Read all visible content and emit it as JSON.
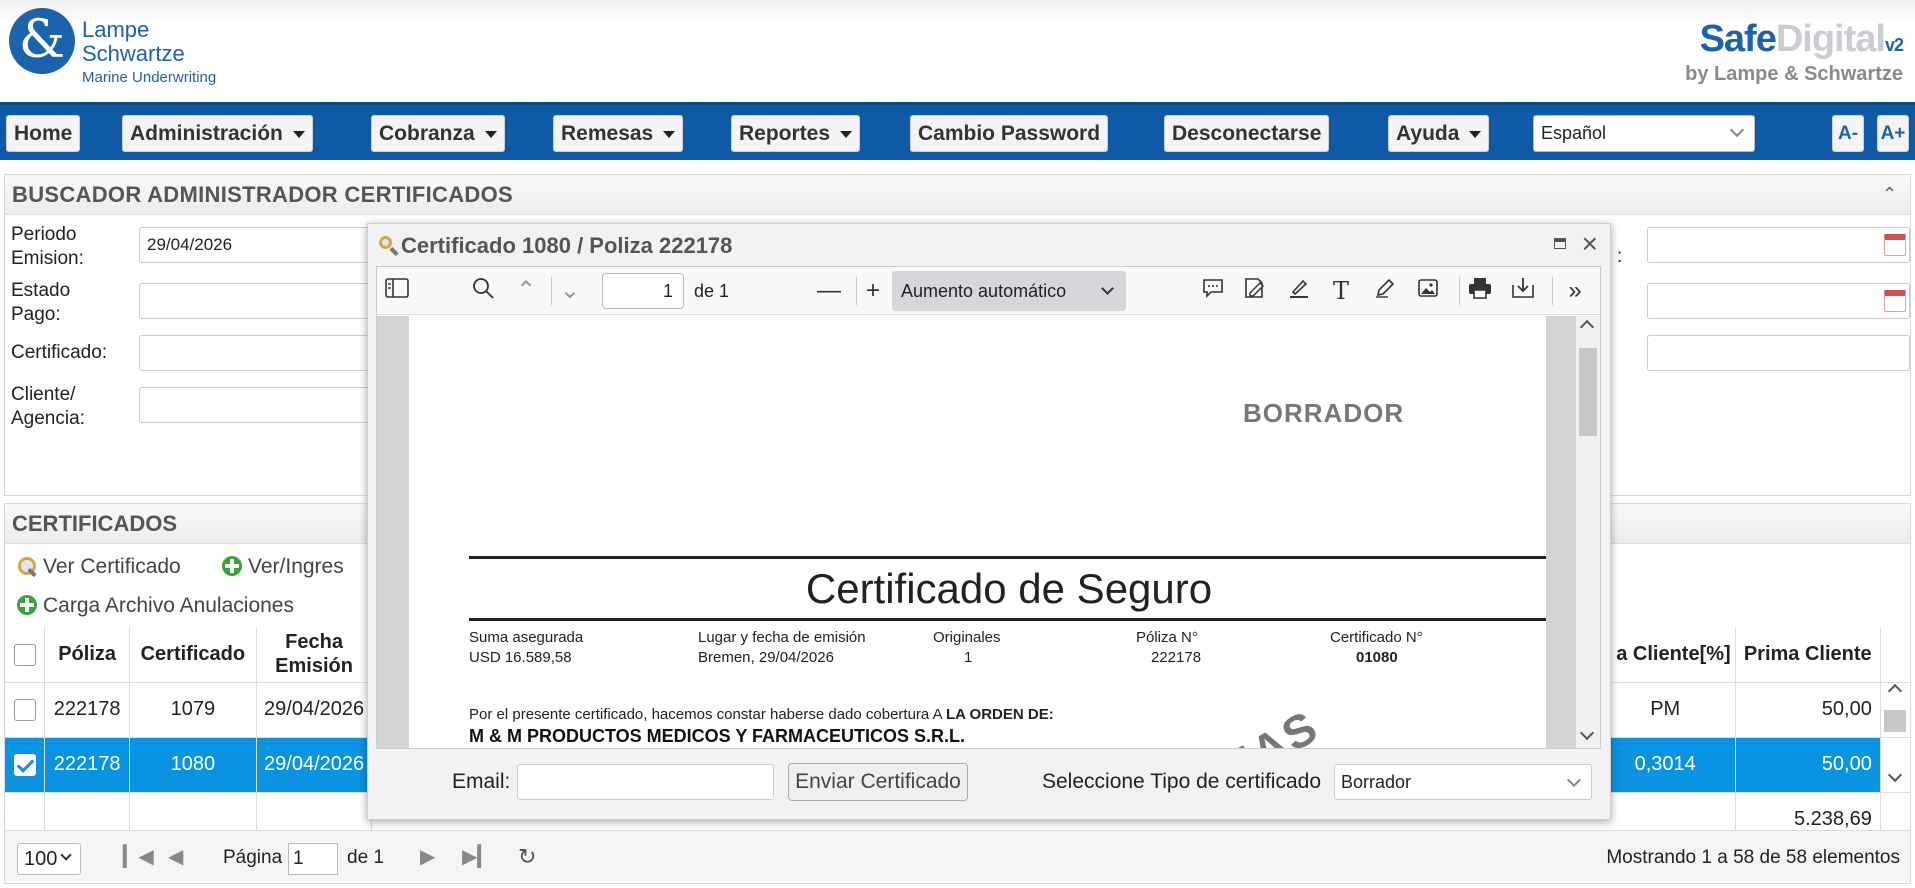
{
  "header": {
    "logo_line1": "Lampe",
    "logo_line2": "Schwartze",
    "logo_line3": "Marine Underwriting",
    "brand_safe": "Safe",
    "brand_digital": "Digital",
    "brand_version": "v2",
    "brand_by": "by Lampe & Schwartze"
  },
  "nav": {
    "home": "Home",
    "administracion": "Administración",
    "cobranza": "Cobranza",
    "remesas": "Remesas",
    "reportes": "Reportes",
    "cambio_password": "Cambio Password",
    "desconectarse": "Desconectarse",
    "ayuda": "Ayuda",
    "language": "Español",
    "font_smaller": "A-",
    "font_larger": "A+"
  },
  "search": {
    "title": "BUSCADOR ADMINISTRADOR CERTIFICADOS",
    "periodo_label_1": "Periodo",
    "periodo_label_2": "Emision:",
    "periodo_value": "29/04/2026",
    "estado_label_1": "Estado",
    "estado_label_2": "Pago:",
    "certificado_label": "Certificado:",
    "cliente_label_1": "Cliente/",
    "cliente_label_2": "Agencia:",
    "right_label_fragment": ":"
  },
  "certificados": {
    "title": "CERTIFICADOS",
    "ver_certificado": "Ver Certificado",
    "ver_ingresar": "Ver/Ingres",
    "carga_archivo": "Carga Archivo Anulaciones",
    "columns": {
      "poliza": "Póliza",
      "certificado": "Certificado",
      "fecha_1": "Fecha",
      "fecha_2": "Emisión",
      "tasa_cliente": "a Cliente[%]",
      "prima_cliente": "Prima Cliente"
    },
    "rows": [
      {
        "poliza": "222178",
        "certificado": "1079",
        "fecha": "29/04/2026",
        "tasa": "PM",
        "prima": "50,00",
        "selected": false
      },
      {
        "poliza": "222178",
        "certificado": "1080",
        "fecha": "29/04/2026",
        "tasa": "0,3014",
        "prima": "50,00",
        "selected": true
      }
    ],
    "total_prima": "5.238,69",
    "pagination": {
      "page_size": "100",
      "pagina_label": "Página",
      "page": "1",
      "de_label": "de 1",
      "summary": "Mostrando 1 a 58 de 58 elementos"
    }
  },
  "modal": {
    "title": "Certificado 1080 / Poliza 222178",
    "pdf": {
      "page_number": "1",
      "page_total": "de 1",
      "zoom": "Aumento automático",
      "watermark": "BORRADOR",
      "watermark_diag": "IAS",
      "doc_title": "Certificado de Seguro",
      "suma_label": "Suma asegurada",
      "suma_value": "USD  16.589,58",
      "lugar_label": "Lugar y fecha de emisión",
      "lugar_value": "Bremen, 29/04/2026",
      "originales_label": "Originales",
      "originales_value": "1",
      "poliza_label": "Póliza N°",
      "poliza_value": "222178",
      "cert_label": "Certificado N°",
      "cert_value": "01080",
      "por_text": "Por el presente certificado, hacemos constar haberse dado cobertura A ",
      "por_bold": "LA ORDEN DE:",
      "client_name": "M & M PRODUCTOS MEDICOS Y FARMACEUTICOS S.R.L."
    },
    "email_label": "Email:",
    "email_value": "",
    "send_button": "Enviar Certificado",
    "tipo_label": "Seleccione Tipo de certificado",
    "tipo_value": "Borrador"
  }
}
